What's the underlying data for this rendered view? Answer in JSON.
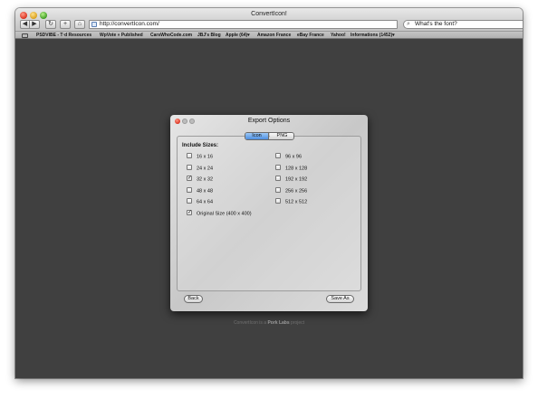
{
  "browser": {
    "title": "ConvertIcon!",
    "url": "http://convertIcon.com/",
    "search_value": "What's the font?",
    "toolbar": {
      "back": "◀",
      "forward": "▶",
      "reload": "↻",
      "add": "+",
      "home": "⌂"
    },
    "bookmarks": [
      "PSDVIBE - T·d Resources",
      "WpVote » Published",
      "CarsWhoCode.com",
      "JBJ's Blog",
      "Apple (64)▾",
      "Amazon France",
      "eBay France",
      "Yahoo!",
      "Informations (1452)▾"
    ]
  },
  "page": {
    "footer_prefix": "ConvertIcon is a",
    "footer_link": "Pork Labs",
    "footer_suffix": "project"
  },
  "dialog": {
    "title": "Export Options",
    "tabs": [
      {
        "label": "Icon",
        "selected": true
      },
      {
        "label": "PNG",
        "selected": false
      }
    ],
    "include_label": "Include Sizes:",
    "sizes_left": [
      {
        "label": "16 x 16",
        "checked": false
      },
      {
        "label": "24 x 24",
        "checked": false
      },
      {
        "label": "32 x 32",
        "checked": true
      },
      {
        "label": "48 x 48",
        "checked": false
      },
      {
        "label": "64 x 64",
        "checked": false
      }
    ],
    "sizes_right": [
      {
        "label": "96 x 96",
        "checked": false
      },
      {
        "label": "128 x 128",
        "checked": false
      },
      {
        "label": "192 x 192",
        "checked": false
      },
      {
        "label": "256 x 256",
        "checked": false
      },
      {
        "label": "512 x 512",
        "checked": false
      }
    ],
    "original": {
      "label": "Original Size (400 x 400)",
      "checked": true
    },
    "back_label": "Back",
    "save_label": "Save As",
    "check_glyph": "✓"
  }
}
